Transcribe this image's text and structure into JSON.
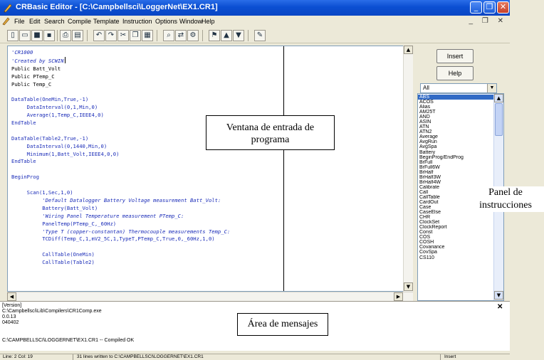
{
  "window": {
    "title": "CRBasic Editor - [C:\\Campbellsci\\LoggerNet\\EX1.CR1]",
    "controls": [
      "_",
      "❐",
      "✕"
    ]
  },
  "menu": {
    "items": [
      "File",
      "Edit",
      "Search",
      "Compile",
      "Template",
      "Instruction",
      "Options",
      "Window",
      "Help"
    ],
    "mdi_controls": "_ ❐ ✕"
  },
  "toolbar": {
    "icons": [
      "new-file-icon",
      "open-icon",
      "save-icon",
      "save-as-icon",
      "print-icon",
      "print-preview-icon",
      "undo-icon",
      "redo-icon",
      "cut-icon",
      "copy-icon",
      "paste-icon",
      "find-icon",
      "replace-icon",
      "compile-icon",
      "bookmark-icon",
      "previous-bookmark-icon",
      "next-bookmark-icon",
      "tools-icon"
    ]
  },
  "editor": {
    "lines": [
      {
        "t": "'CR1000",
        "c": "cm"
      },
      {
        "t": "'Created by SCWIN",
        "c": "cm",
        "caret": true
      },
      {
        "t": "Public Batt_Volt",
        "c": ""
      },
      {
        "t": "Public PTemp_C",
        "c": ""
      },
      {
        "t": "Public Temp_C",
        "c": ""
      },
      {
        "t": "",
        "c": ""
      },
      {
        "t": "DataTable(OneMin,True,-1)",
        "c": "kw"
      },
      {
        "t": "     DataInterval(0,1,Min,0)",
        "c": "kw"
      },
      {
        "t": "     Average(1,Temp_C,IEEE4,0)",
        "c": "kw"
      },
      {
        "t": "EndTable",
        "c": "kw"
      },
      {
        "t": "",
        "c": ""
      },
      {
        "t": "DataTable(Table2,True,-1)",
        "c": "kw"
      },
      {
        "t": "     DataInterval(0,1440,Min,0)",
        "c": "kw"
      },
      {
        "t": "     Minimum(1,Batt_Volt,IEEE4,0,0)",
        "c": "kw"
      },
      {
        "t": "EndTable",
        "c": "kw"
      },
      {
        "t": "",
        "c": ""
      },
      {
        "t": "BeginProg",
        "c": "kw"
      },
      {
        "t": "",
        "c": ""
      },
      {
        "t": "     Scan(1,Sec,1,0)",
        "c": "kw"
      },
      {
        "t": "          'Default Datalogger Battery Voltage measurement Batt_Volt:",
        "c": "cm"
      },
      {
        "t": "          Battery(Batt_Volt)",
        "c": "kw"
      },
      {
        "t": "          'Wiring Panel Temperature measurement PTemp_C:",
        "c": "cm"
      },
      {
        "t": "          PanelTemp(PTemp_C,_60Hz)",
        "c": "kw"
      },
      {
        "t": "          'Type T (copper-constantan) Thermocouple measurements Temp_C:",
        "c": "cm"
      },
      {
        "t": "          TCDiff(Temp_C,1,mV2_5C,1,TypeT,PTemp_C,True,0,_60Hz,1,0)",
        "c": "kw"
      },
      {
        "t": "",
        "c": ""
      },
      {
        "t": "          CallTable(OneMin)",
        "c": "kw"
      },
      {
        "t": "          CallTable(Table2)",
        "c": "kw"
      }
    ]
  },
  "panel": {
    "insert_label": "Insert",
    "help_label": "Help",
    "category": "All",
    "instructions": [
      "ABS",
      "ACOS",
      "Alias",
      "AM25T",
      "AND",
      "ASIN",
      "ATN",
      "ATN2",
      "Average",
      "AvgRun",
      "AvgSpa",
      "Battery",
      "BeginProg/EndProg",
      "BrFull",
      "BrFull6W",
      "BrHalf",
      "BrHalf3W",
      "BrHalf4W",
      "Calibrate",
      "Call",
      "CallTable",
      "CardOut",
      "Case",
      "CaseElse",
      "CHR",
      "ClockSet",
      "ClockReport",
      "Const",
      "COS",
      "COSH",
      "Covariance",
      "CovSpa",
      "CS110"
    ],
    "selected_index": 0
  },
  "messages": {
    "lines": [
      "[Version]",
      "C:\\Campbellsci\\Lib\\Compilers\\CR1Comp.exe",
      "0.0.13",
      "040402",
      "",
      "C:\\CAMPBELLSCI\\LOGGERNET\\EX1.CR1 -- Compiled OK"
    ]
  },
  "status": {
    "position": "Line: 2 Col: 19",
    "message": "31 lines written to C:\\CAMPBELLSCI\\LOGGERNET\\EX1.CR1",
    "mode": "Insert"
  },
  "callouts": {
    "program_line1": "Ventana de entrada de",
    "program_line2": "programa",
    "instructions_line1": "Panel de",
    "instructions_line2": "instrucciones",
    "messages": "Área de mensajes"
  }
}
